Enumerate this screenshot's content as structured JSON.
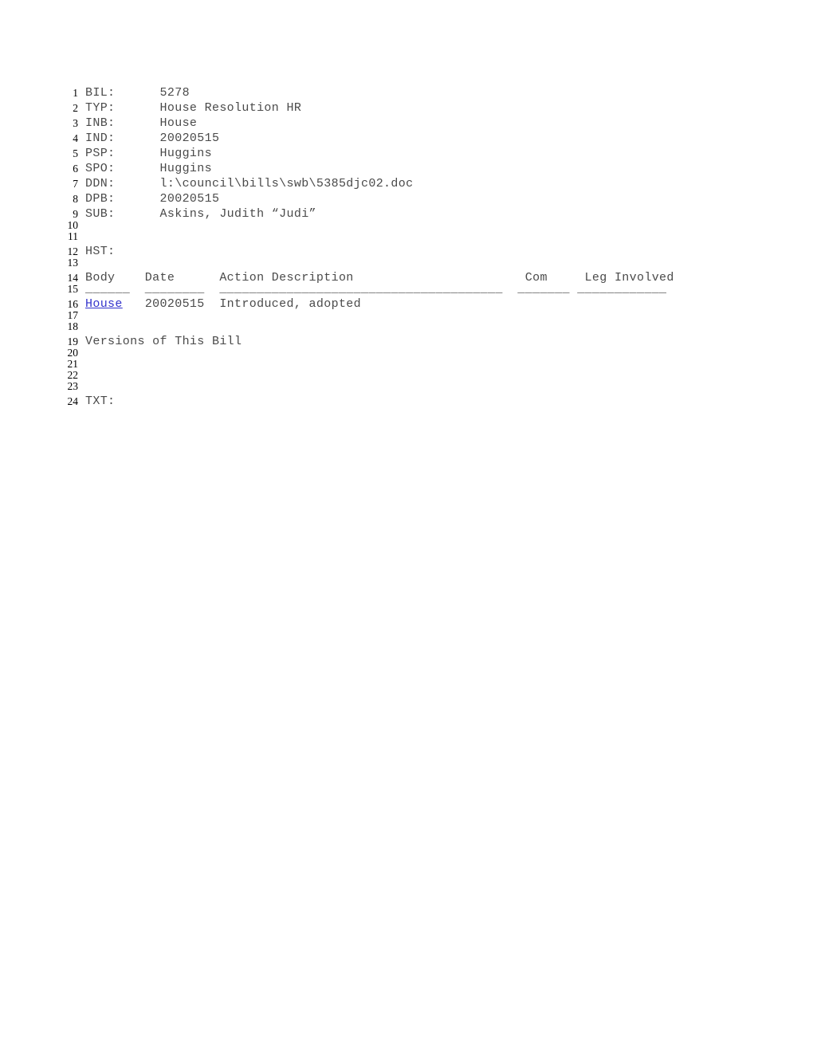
{
  "document": {
    "fields": [
      {
        "key": "BIL:",
        "value": "5278"
      },
      {
        "key": "TYP:",
        "value": "House Resolution HR"
      },
      {
        "key": "INB:",
        "value": "House"
      },
      {
        "key": "IND:",
        "value": "20020515"
      },
      {
        "key": "PSP:",
        "value": "Huggins"
      },
      {
        "key": "SPO:",
        "value": "Huggins"
      },
      {
        "key": "DDN:",
        "value": "l:\\council\\bills\\swb\\5385djc02.doc"
      },
      {
        "key": "DPB:",
        "value": "20020515"
      },
      {
        "key": "SUB:",
        "value": "Askins, Judith “Judi”"
      }
    ],
    "history_label": "HST:",
    "history_table": {
      "headers": [
        "Body",
        "Date",
        "Action Description",
        "Com",
        "Leg Involved"
      ],
      "separators": [
        "______",
        "________",
        "______________________________",
        "_______",
        "____________"
      ],
      "rows": [
        {
          "body": "House",
          "body_is_link": true,
          "date": "20020515",
          "action": "Introduced, adopted",
          "com": "",
          "leg_involved": ""
        }
      ]
    },
    "versions_label": "Versions of This Bill",
    "text_label": "TXT:"
  },
  "lines": [
    {
      "n": "1",
      "text": "BIL:      5278"
    },
    {
      "n": "2",
      "text": "TYP:      House Resolution HR"
    },
    {
      "n": "3",
      "text": "INB:      House"
    },
    {
      "n": "4",
      "text": "IND:      20020515"
    },
    {
      "n": "5",
      "text": "PSP:      Huggins"
    },
    {
      "n": "6",
      "text": "SPO:      Huggins"
    },
    {
      "n": "7",
      "text": "DDN:      l:\\council\\bills\\swb\\5385djc02.doc"
    },
    {
      "n": "8",
      "text": "DPB:      20020515"
    },
    {
      "n": "9",
      "text": "SUB:      Askins, Judith “Judi”"
    },
    {
      "n": "10",
      "text": ""
    },
    {
      "n": "11",
      "text": ""
    },
    {
      "n": "12",
      "text": "HST:"
    },
    {
      "n": "13",
      "text": ""
    },
    {
      "n": "14",
      "text": "Body    Date      Action Description                       Com     Leg Involved"
    },
    {
      "n": "15",
      "text": "______  ________  ______________________________________  _______ ____________"
    },
    {
      "n": "16",
      "text": "House   20020515  Introduced, adopted"
    },
    {
      "n": "17",
      "text": ""
    },
    {
      "n": "18",
      "text": ""
    },
    {
      "n": "19",
      "text": "Versions of This Bill"
    },
    {
      "n": "20",
      "text": ""
    },
    {
      "n": "21",
      "text": ""
    },
    {
      "n": "22",
      "text": ""
    },
    {
      "n": "23",
      "text": ""
    },
    {
      "n": "24",
      "text": "TXT:"
    }
  ],
  "link_line": {
    "prefix": "",
    "link_text": "House",
    "suffix": "   20020515  Introduced, adopted"
  },
  "colors": {
    "text": "#4a4a4a",
    "line_number": "#000000",
    "link": "#3333cc",
    "background": "#ffffff"
  }
}
